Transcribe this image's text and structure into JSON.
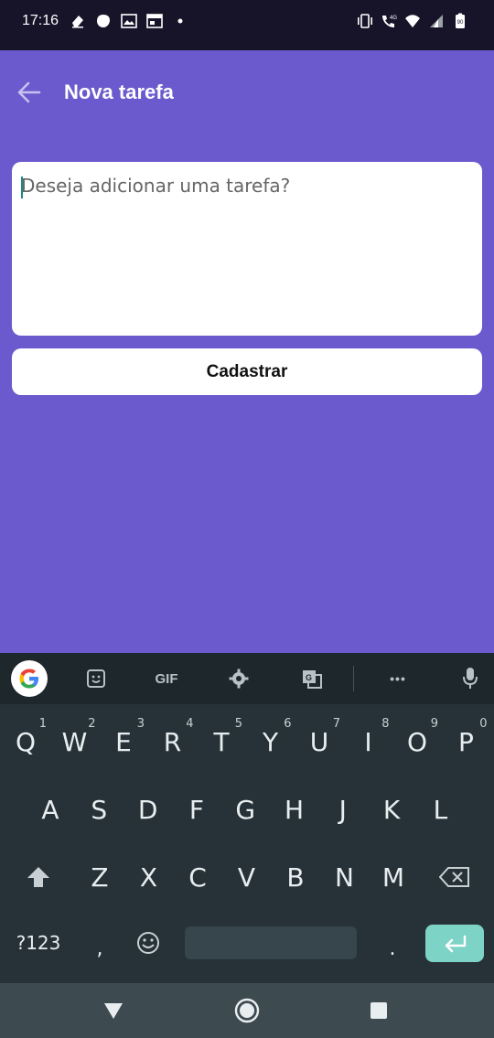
{
  "status_bar": {
    "time": "17:16",
    "left_icons": [
      "eraser-icon",
      "shield-icon",
      "image-icon",
      "calendar-icon",
      "dot-icon"
    ],
    "right_icons": [
      "vibrate-icon",
      "call-4g-icon",
      "wifi-icon",
      "signal-icon",
      "battery-icon"
    ],
    "battery_text": "90",
    "network_text": "4G"
  },
  "app_bar": {
    "title": "Nova tarefa",
    "back_icon": "arrow-left-icon"
  },
  "form": {
    "input_placeholder": "Deseja adicionar uma tarefa?",
    "input_value": "",
    "submit_label": "Cadastrar"
  },
  "keyboard": {
    "toolbar": {
      "gif_label": "GIF",
      "more_label": "•••"
    },
    "row1": [
      {
        "k": "Q",
        "h": "1"
      },
      {
        "k": "W",
        "h": "2"
      },
      {
        "k": "E",
        "h": "3"
      },
      {
        "k": "R",
        "h": "4"
      },
      {
        "k": "T",
        "h": "5"
      },
      {
        "k": "Y",
        "h": "6"
      },
      {
        "k": "U",
        "h": "7"
      },
      {
        "k": "I",
        "h": "8"
      },
      {
        "k": "O",
        "h": "9"
      },
      {
        "k": "P",
        "h": "0"
      }
    ],
    "row2": [
      "A",
      "S",
      "D",
      "F",
      "G",
      "H",
      "J",
      "K",
      "L"
    ],
    "row3": [
      "Z",
      "X",
      "C",
      "V",
      "B",
      "N",
      "M"
    ],
    "symbols_label": "?123",
    "comma_label": ",",
    "period_label": "."
  },
  "colors": {
    "background": "#6a5acd",
    "status_bar": "#17142a",
    "keyboard": "#263238",
    "enter_key": "#7dd3c6",
    "nav_bar": "#3d4a50"
  }
}
